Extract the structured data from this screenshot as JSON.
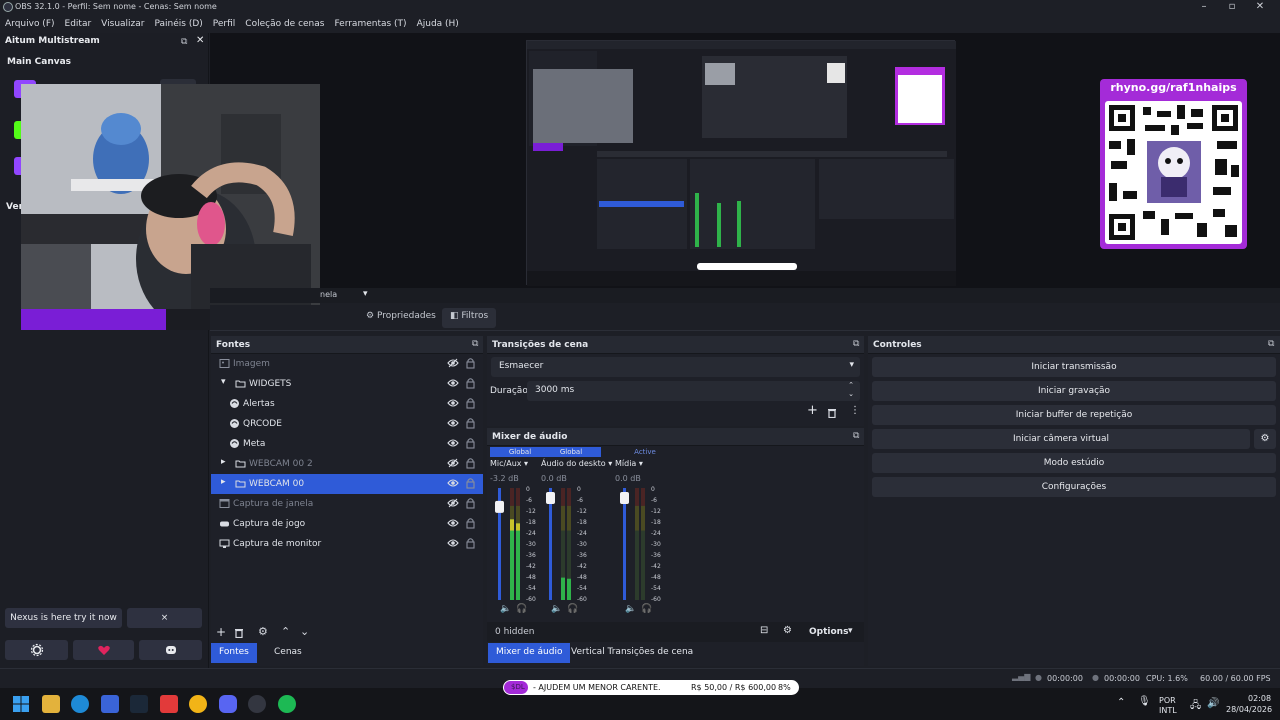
{
  "window": {
    "title": "OBS 32.1.0 - Perfil: Sem nome - Cenas: Sem nome"
  },
  "menu": [
    "Arquivo (F)",
    "Editar",
    "Visualizar",
    "Painéis (D)",
    "Perfil",
    "Coleção de cenas",
    "Ferramentas (T)",
    "Ajuda (H)"
  ],
  "multistream": {
    "title": "Aitum Multistream",
    "section": "Main Canvas",
    "partial_label": "Ver",
    "nexus_label": "Nexus is here try it now",
    "close_label": "×"
  },
  "preview": {
    "qr_label": "rhyno.gg/raf1nhaips",
    "scene_label_fragment": "nela"
  },
  "prop_tabs": {
    "properties": "Propriedades",
    "filters": "Filtros"
  },
  "sources": {
    "title": "Fontes",
    "items": [
      {
        "label": "Imagem",
        "dim": true
      },
      {
        "label": "WIDGETS",
        "dim": false
      },
      {
        "label": "Alertas",
        "dim": false
      },
      {
        "label": "QRCODE",
        "dim": false
      },
      {
        "label": "Meta",
        "dim": false
      },
      {
        "label": "WEBCAM 00 2",
        "dim": true
      },
      {
        "label": "WEBCAM 00",
        "dim": false,
        "selected": true
      },
      {
        "label": "Captura de janela",
        "dim": true
      },
      {
        "label": "Captura de jogo",
        "dim": false
      },
      {
        "label": "Captura de monitor",
        "dim": false
      }
    ]
  },
  "bottom_tabs_left": [
    "Fontes",
    "Cenas"
  ],
  "transitions": {
    "title": "Transições de cena",
    "selected": "Esmaecer",
    "duration_label": "Duração",
    "duration_value": "3000 ms"
  },
  "mixer": {
    "title": "Mixer de áudio",
    "channels": [
      {
        "header": "Global",
        "name": "Mic/Aux",
        "db": "-3.2 dB",
        "level": 0.72,
        "fader": 0.84
      },
      {
        "header": "Global",
        "name": "Áudio do deskto",
        "db": "0.0 dB",
        "level": 0.2,
        "fader": 0.92
      },
      {
        "header": "Active",
        "name": "Mídia",
        "db": "0.0 dB",
        "level": 0.0,
        "fader": 0.92
      }
    ],
    "scale": [
      "0",
      "-6",
      "-12",
      "-18",
      "-24",
      "-30",
      "-36",
      "-42",
      "-48",
      "-54",
      "-60"
    ],
    "hidden": "0 hidden",
    "options": "Options"
  },
  "bottom_tabs_mid": [
    "Mixer de áudio",
    "Vertical Transições de cena"
  ],
  "controls": {
    "title": "Controles",
    "buttons": [
      "Iniciar transmissão",
      "Iniciar gravação",
      "Iniciar buffer de repetição",
      "Iniciar câmera virtual",
      "Modo estúdio",
      "Configurações"
    ]
  },
  "status": {
    "rec1": "00:00:00",
    "rec2": "00:00:00",
    "cpu": "CPU: 1.6%",
    "fps": "60.00 / 60.00 FPS"
  },
  "donation": {
    "tag": "$DL",
    "text": "- AJUDEM UM MENOR CARENTE.",
    "amount": "R$ 50,00 / R$ 600,00",
    "pct": "8%"
  },
  "tray": {
    "lang1": "POR",
    "lang2": "INTL",
    "time": "02:08",
    "date": "28/04/2026"
  },
  "colors": {
    "accent": "#2f5bd8",
    "purple": "#a42bd8",
    "meter_green": "#2fb34a",
    "meter_yellow": "#c9c12b",
    "meter_red": "#c3322b"
  }
}
